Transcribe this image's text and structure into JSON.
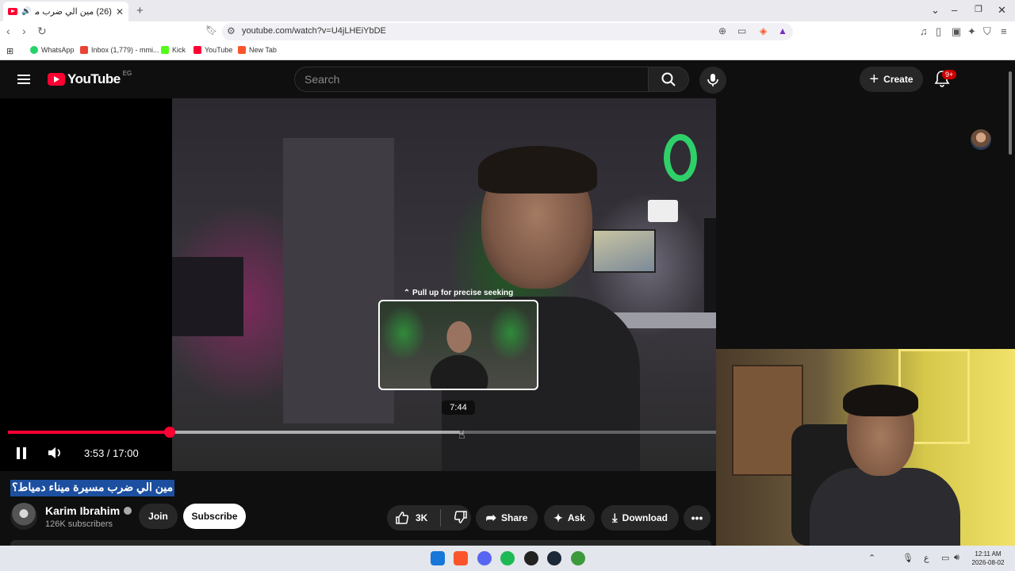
{
  "browser": {
    "tab_title": "(26) مين الي ضرب مسيرة ميناء...",
    "tab_close": "✕",
    "new_tab": "+",
    "url": "youtube.com/watch?v=U4jLHEiYbDE",
    "bookmarks": [
      {
        "label": "WhatsApp",
        "color": "#25d366"
      },
      {
        "label": "Inbox (1,779) - mmi...",
        "color": "#ea4335"
      },
      {
        "label": "Kick",
        "color": "#53fc18"
      },
      {
        "label": "YouTube",
        "color": "#ff0033"
      },
      {
        "label": "New Tab",
        "color": "#fb542b"
      }
    ]
  },
  "youtube": {
    "logo_text": "YouTube",
    "region": "EG",
    "search_placeholder": "Search",
    "create_label": "Create",
    "notification_badge": "9+",
    "accent": "#ff0033"
  },
  "player": {
    "preview_hint": "Pull up for precise seeking",
    "preview_time": "7:44",
    "time_display": "3:53 / 17:00",
    "played_fraction": 0.2284,
    "buffered_fraction": 0.638,
    "playing": true
  },
  "video": {
    "title": "مين الي ضرب مسيرة ميناء دمياط؟",
    "channel_name": "Karim Ibrahim",
    "subscribers": "126K subscribers",
    "join_label": "Join",
    "subscribe_label": "Subscribe",
    "like_count": "3K",
    "share_label": "Share",
    "ask_label": "Ask",
    "download_label": "Download"
  },
  "taskbar": {
    "time": "12:11 AM",
    "date": "2026-08-02",
    "lang": "ع"
  }
}
